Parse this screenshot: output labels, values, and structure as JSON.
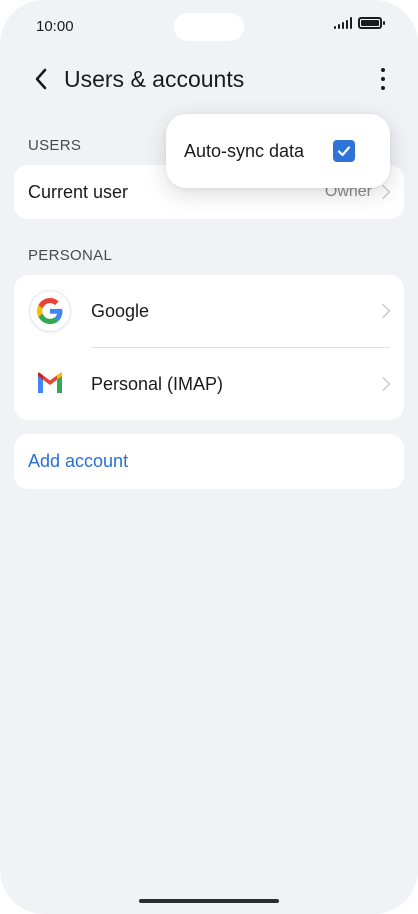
{
  "status_bar": {
    "time": "10:00",
    "signal_icon": "signal-icon",
    "battery_icon": "battery-icon"
  },
  "app_bar": {
    "title": "Users & accounts",
    "back_icon": "back-arrow-icon",
    "more_icon": "more-vert-icon"
  },
  "users_section": {
    "header": "USERS",
    "current_user_label": "Current user",
    "current_user_value": "Owner"
  },
  "personal_section": {
    "header": "PERSONAL",
    "accounts": [
      {
        "label": "Google",
        "icon": "google-icon"
      },
      {
        "label": "Personal (IMAP)",
        "icon": "gmail-icon"
      }
    ]
  },
  "add_account": {
    "label": "Add account"
  },
  "popup_menu": {
    "auto_sync_label": "Auto-sync data",
    "auto_sync_checked": true
  },
  "colors": {
    "background": "#f1f2f6",
    "card": "#ffffff",
    "accent": "#2a6fd6",
    "checkbox": "#2f73d8"
  }
}
